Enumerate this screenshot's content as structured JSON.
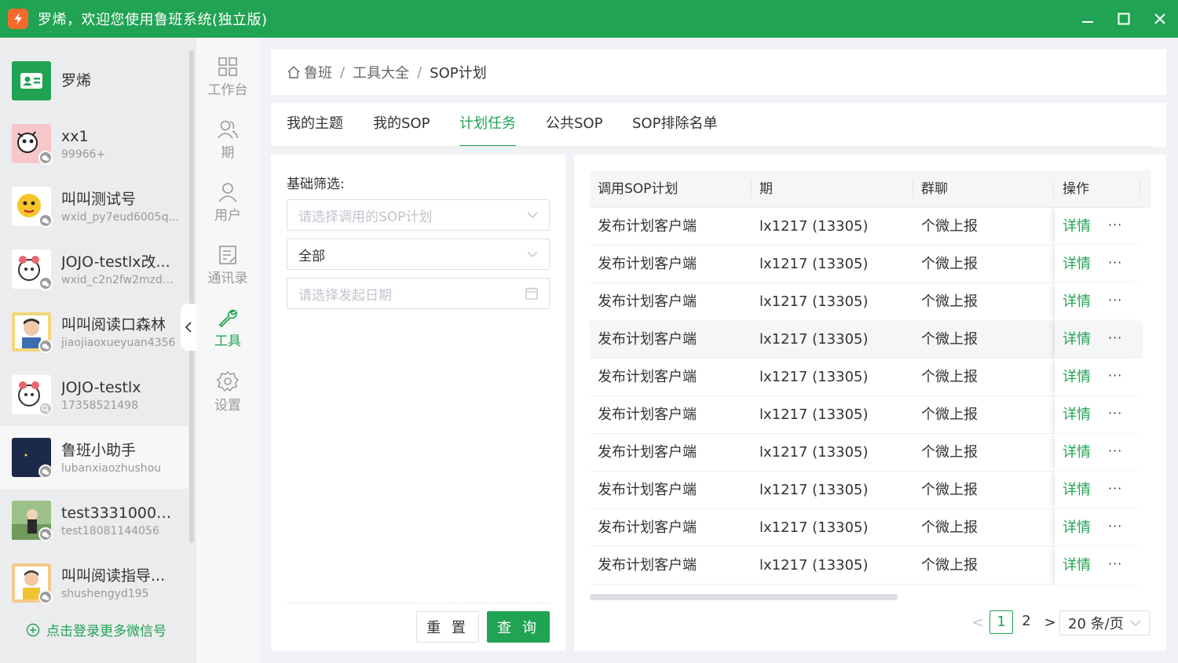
{
  "window": {
    "title": "罗烯，欢迎您使用鲁班系统(独立版)"
  },
  "accounts": [
    {
      "name": "罗烯",
      "sub": ""
    },
    {
      "name": "xx1",
      "sub": "99966+"
    },
    {
      "name": "叫叫测试号",
      "sub": "wxid_py7eud6005q..."
    },
    {
      "name": "JOJO-testlx改...",
      "sub": "wxid_c2n2fw2mzd0..."
    },
    {
      "name": "叫叫阅读口森林",
      "sub": "jiaojiaoxueyuan4356"
    },
    {
      "name": "JOJO-testlx",
      "sub": "17358521498"
    },
    {
      "name": "鲁班小助手",
      "sub": "lubanxiaozhushou"
    },
    {
      "name": "test33310000...",
      "sub": "test18081144056"
    },
    {
      "name": "叫叫阅读指导...",
      "sub": "shushengyd195"
    }
  ],
  "login_more": "点击登录更多微信号",
  "nav": [
    {
      "label": "工作台"
    },
    {
      "label": "期"
    },
    {
      "label": "用户"
    },
    {
      "label": "通讯录"
    },
    {
      "label": "工具"
    },
    {
      "label": "设置"
    }
  ],
  "breadcrumb": {
    "home": "鲁班",
    "level2": "工具大全",
    "current": "SOP计划"
  },
  "tabs": [
    {
      "label": "我的主题"
    },
    {
      "label": "我的SOP"
    },
    {
      "label": "计划任务"
    },
    {
      "label": "公共SOP"
    },
    {
      "label": "SOP排除名单"
    }
  ],
  "filter": {
    "title": "基础筛选:",
    "plan_placeholder": "请选择调用的SOP计划",
    "status_value": "全部",
    "date_placeholder": "请选择发起日期",
    "reset_label": "重 置",
    "search_label": "查 询"
  },
  "table": {
    "columns": [
      "调用SOP计划",
      "期",
      "群聊",
      "操作"
    ],
    "detail_label": "详情",
    "more_label": "···",
    "rows": [
      {
        "plan": "发布计划客户端",
        "period": "lx1217 (13305)",
        "group": "个微上报"
      },
      {
        "plan": "发布计划客户端",
        "period": "lx1217 (13305)",
        "group": "个微上报"
      },
      {
        "plan": "发布计划客户端",
        "period": "lx1217 (13305)",
        "group": "个微上报"
      },
      {
        "plan": "发布计划客户端",
        "period": "lx1217 (13305)",
        "group": "个微上报"
      },
      {
        "plan": "发布计划客户端",
        "period": "lx1217 (13305)",
        "group": "个微上报"
      },
      {
        "plan": "发布计划客户端",
        "period": "lx1217 (13305)",
        "group": "个微上报"
      },
      {
        "plan": "发布计划客户端",
        "period": "lx1217 (13305)",
        "group": "个微上报"
      },
      {
        "plan": "发布计划客户端",
        "period": "lx1217 (13305)",
        "group": "个微上报"
      },
      {
        "plan": "发布计划客户端",
        "period": "lx1217 (13305)",
        "group": "个微上报"
      },
      {
        "plan": "发布计划客户端",
        "period": "lx1217 (13305)",
        "group": "个微上报"
      }
    ]
  },
  "pagination": {
    "prev": "<",
    "pages": [
      "1",
      "2"
    ],
    "next": ">",
    "page_size": "20 条/页"
  },
  "colors": {
    "brand": "#20a353",
    "titlebar": "#20a353"
  }
}
